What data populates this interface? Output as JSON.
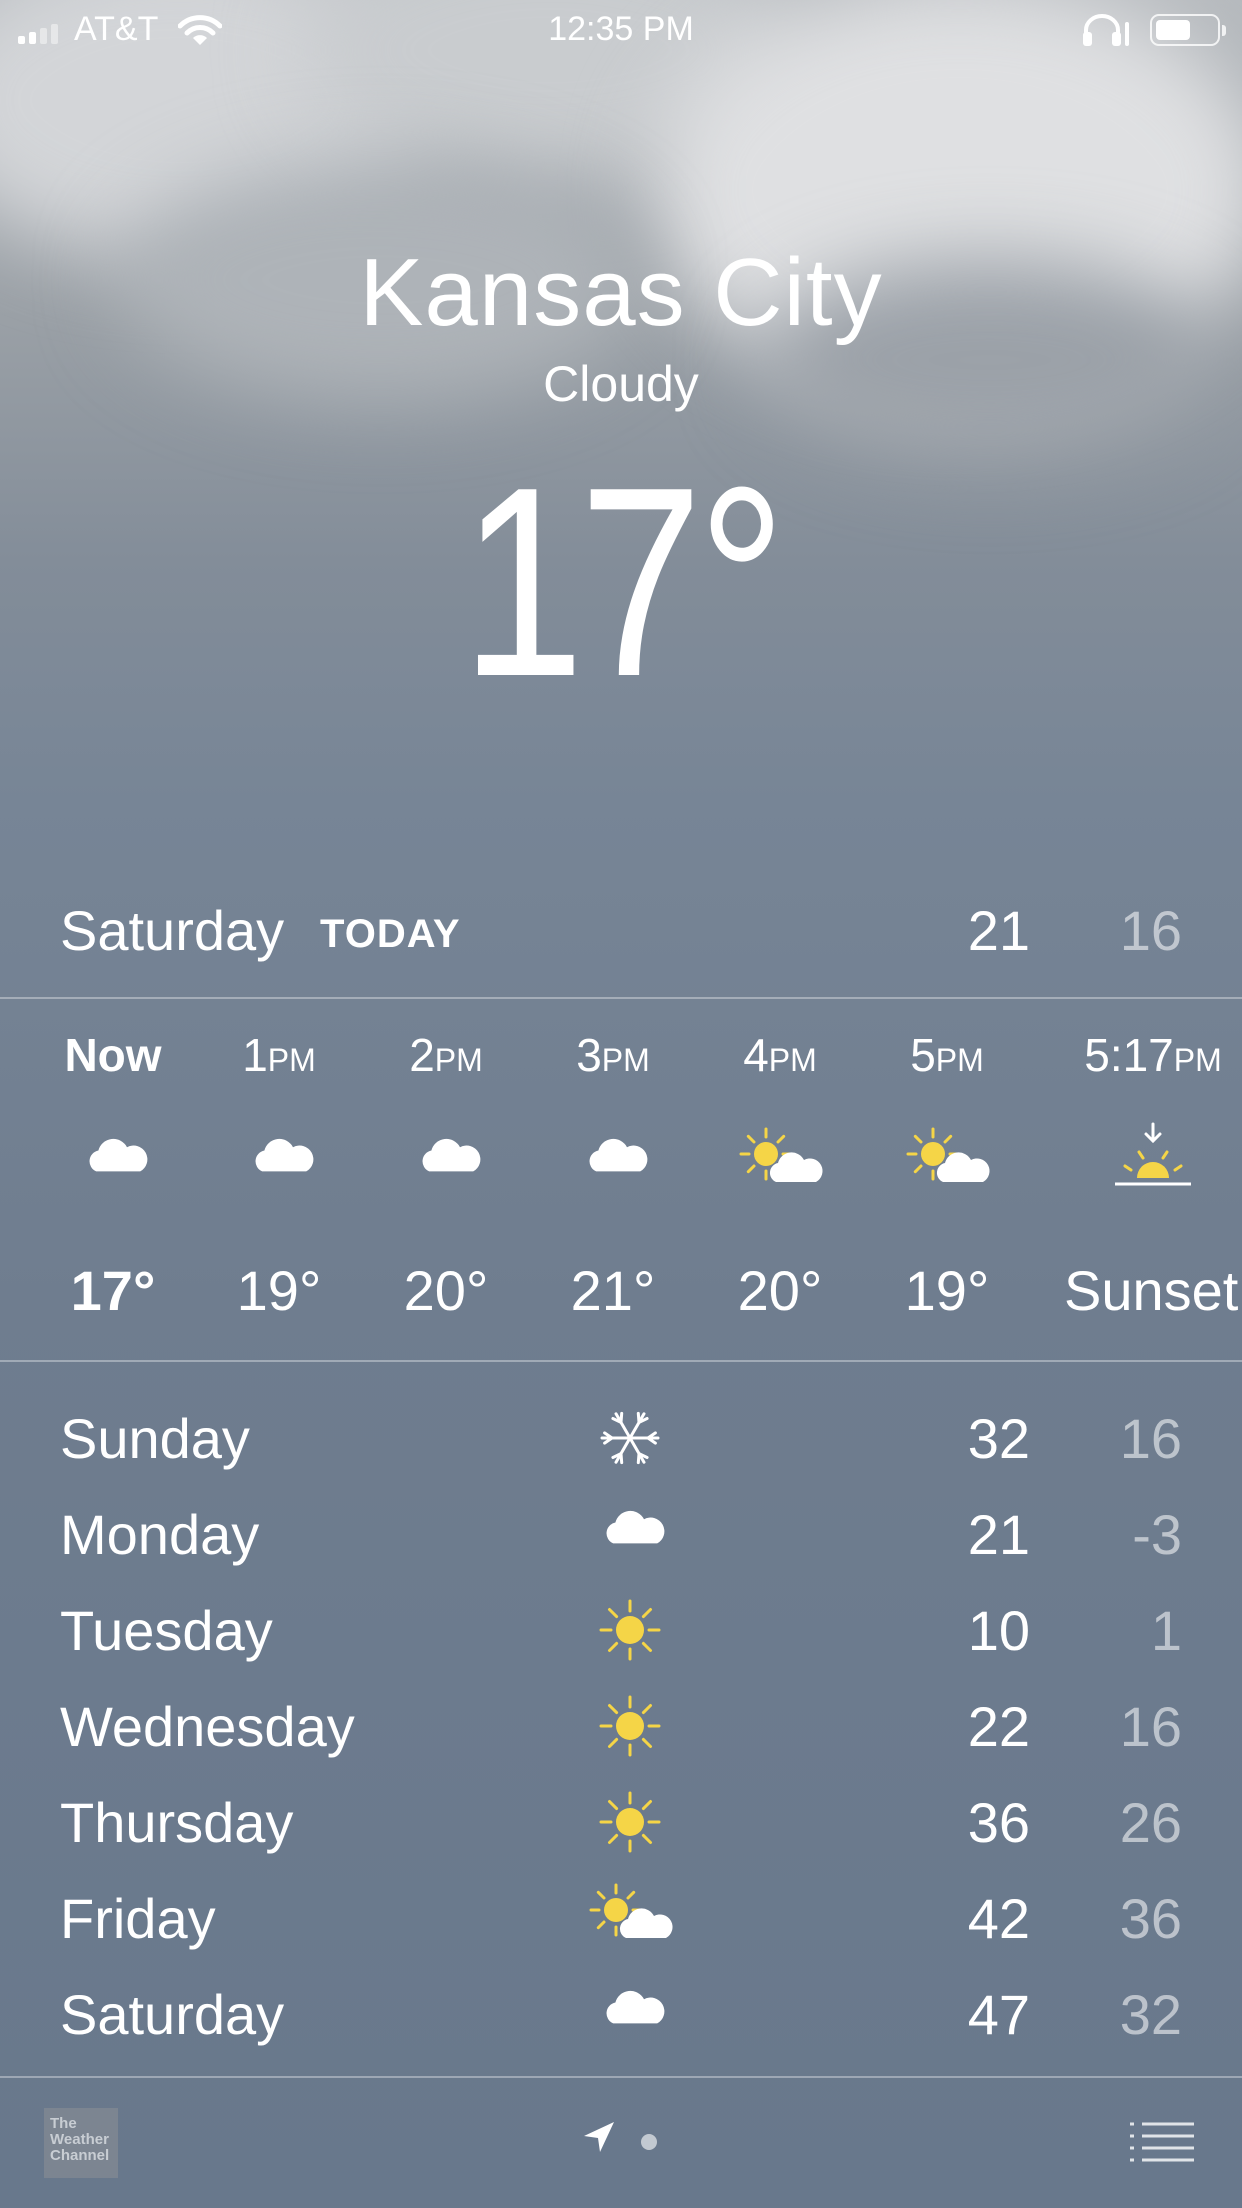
{
  "status_bar": {
    "carrier": "AT&T",
    "time": "12:35 PM"
  },
  "header": {
    "city": "Kansas City",
    "condition": "Cloudy",
    "temperature": "17°"
  },
  "today": {
    "day": "Saturday",
    "label": "TODAY",
    "high": "21",
    "low": "16"
  },
  "hourly": [
    {
      "time": "Now",
      "suffix": "",
      "icon": "cloud-icon",
      "temp": "17°"
    },
    {
      "time": "1",
      "suffix": "PM",
      "icon": "cloud-icon",
      "temp": "19°"
    },
    {
      "time": "2",
      "suffix": "PM",
      "icon": "cloud-icon",
      "temp": "20°"
    },
    {
      "time": "3",
      "suffix": "PM",
      "icon": "cloud-icon",
      "temp": "21°"
    },
    {
      "time": "4",
      "suffix": "PM",
      "icon": "partly-sunny-icon",
      "temp": "20°"
    },
    {
      "time": "5",
      "suffix": "PM",
      "icon": "partly-sunny-icon",
      "temp": "19°"
    },
    {
      "time": "5:17",
      "suffix": "PM",
      "icon": "sunset-icon",
      "temp": "Sunset"
    }
  ],
  "daily": [
    {
      "day": "Sunday",
      "icon": "snowflake-icon",
      "high": "32",
      "low": "16"
    },
    {
      "day": "Monday",
      "icon": "cloud-icon",
      "high": "21",
      "low": "-3"
    },
    {
      "day": "Tuesday",
      "icon": "sun-icon",
      "high": "10",
      "low": "1"
    },
    {
      "day": "Wednesday",
      "icon": "sun-icon",
      "high": "22",
      "low": "16"
    },
    {
      "day": "Thursday",
      "icon": "sun-icon",
      "high": "36",
      "low": "26"
    },
    {
      "day": "Friday",
      "icon": "partly-sunny-icon",
      "high": "42",
      "low": "36"
    },
    {
      "day": "Saturday",
      "icon": "cloud-icon",
      "high": "47",
      "low": "32"
    }
  ],
  "footer": {
    "logo_text": "The Weather Channel"
  },
  "colors": {
    "sun": "#f5d547",
    "low_temp": "#b7c0cb"
  }
}
